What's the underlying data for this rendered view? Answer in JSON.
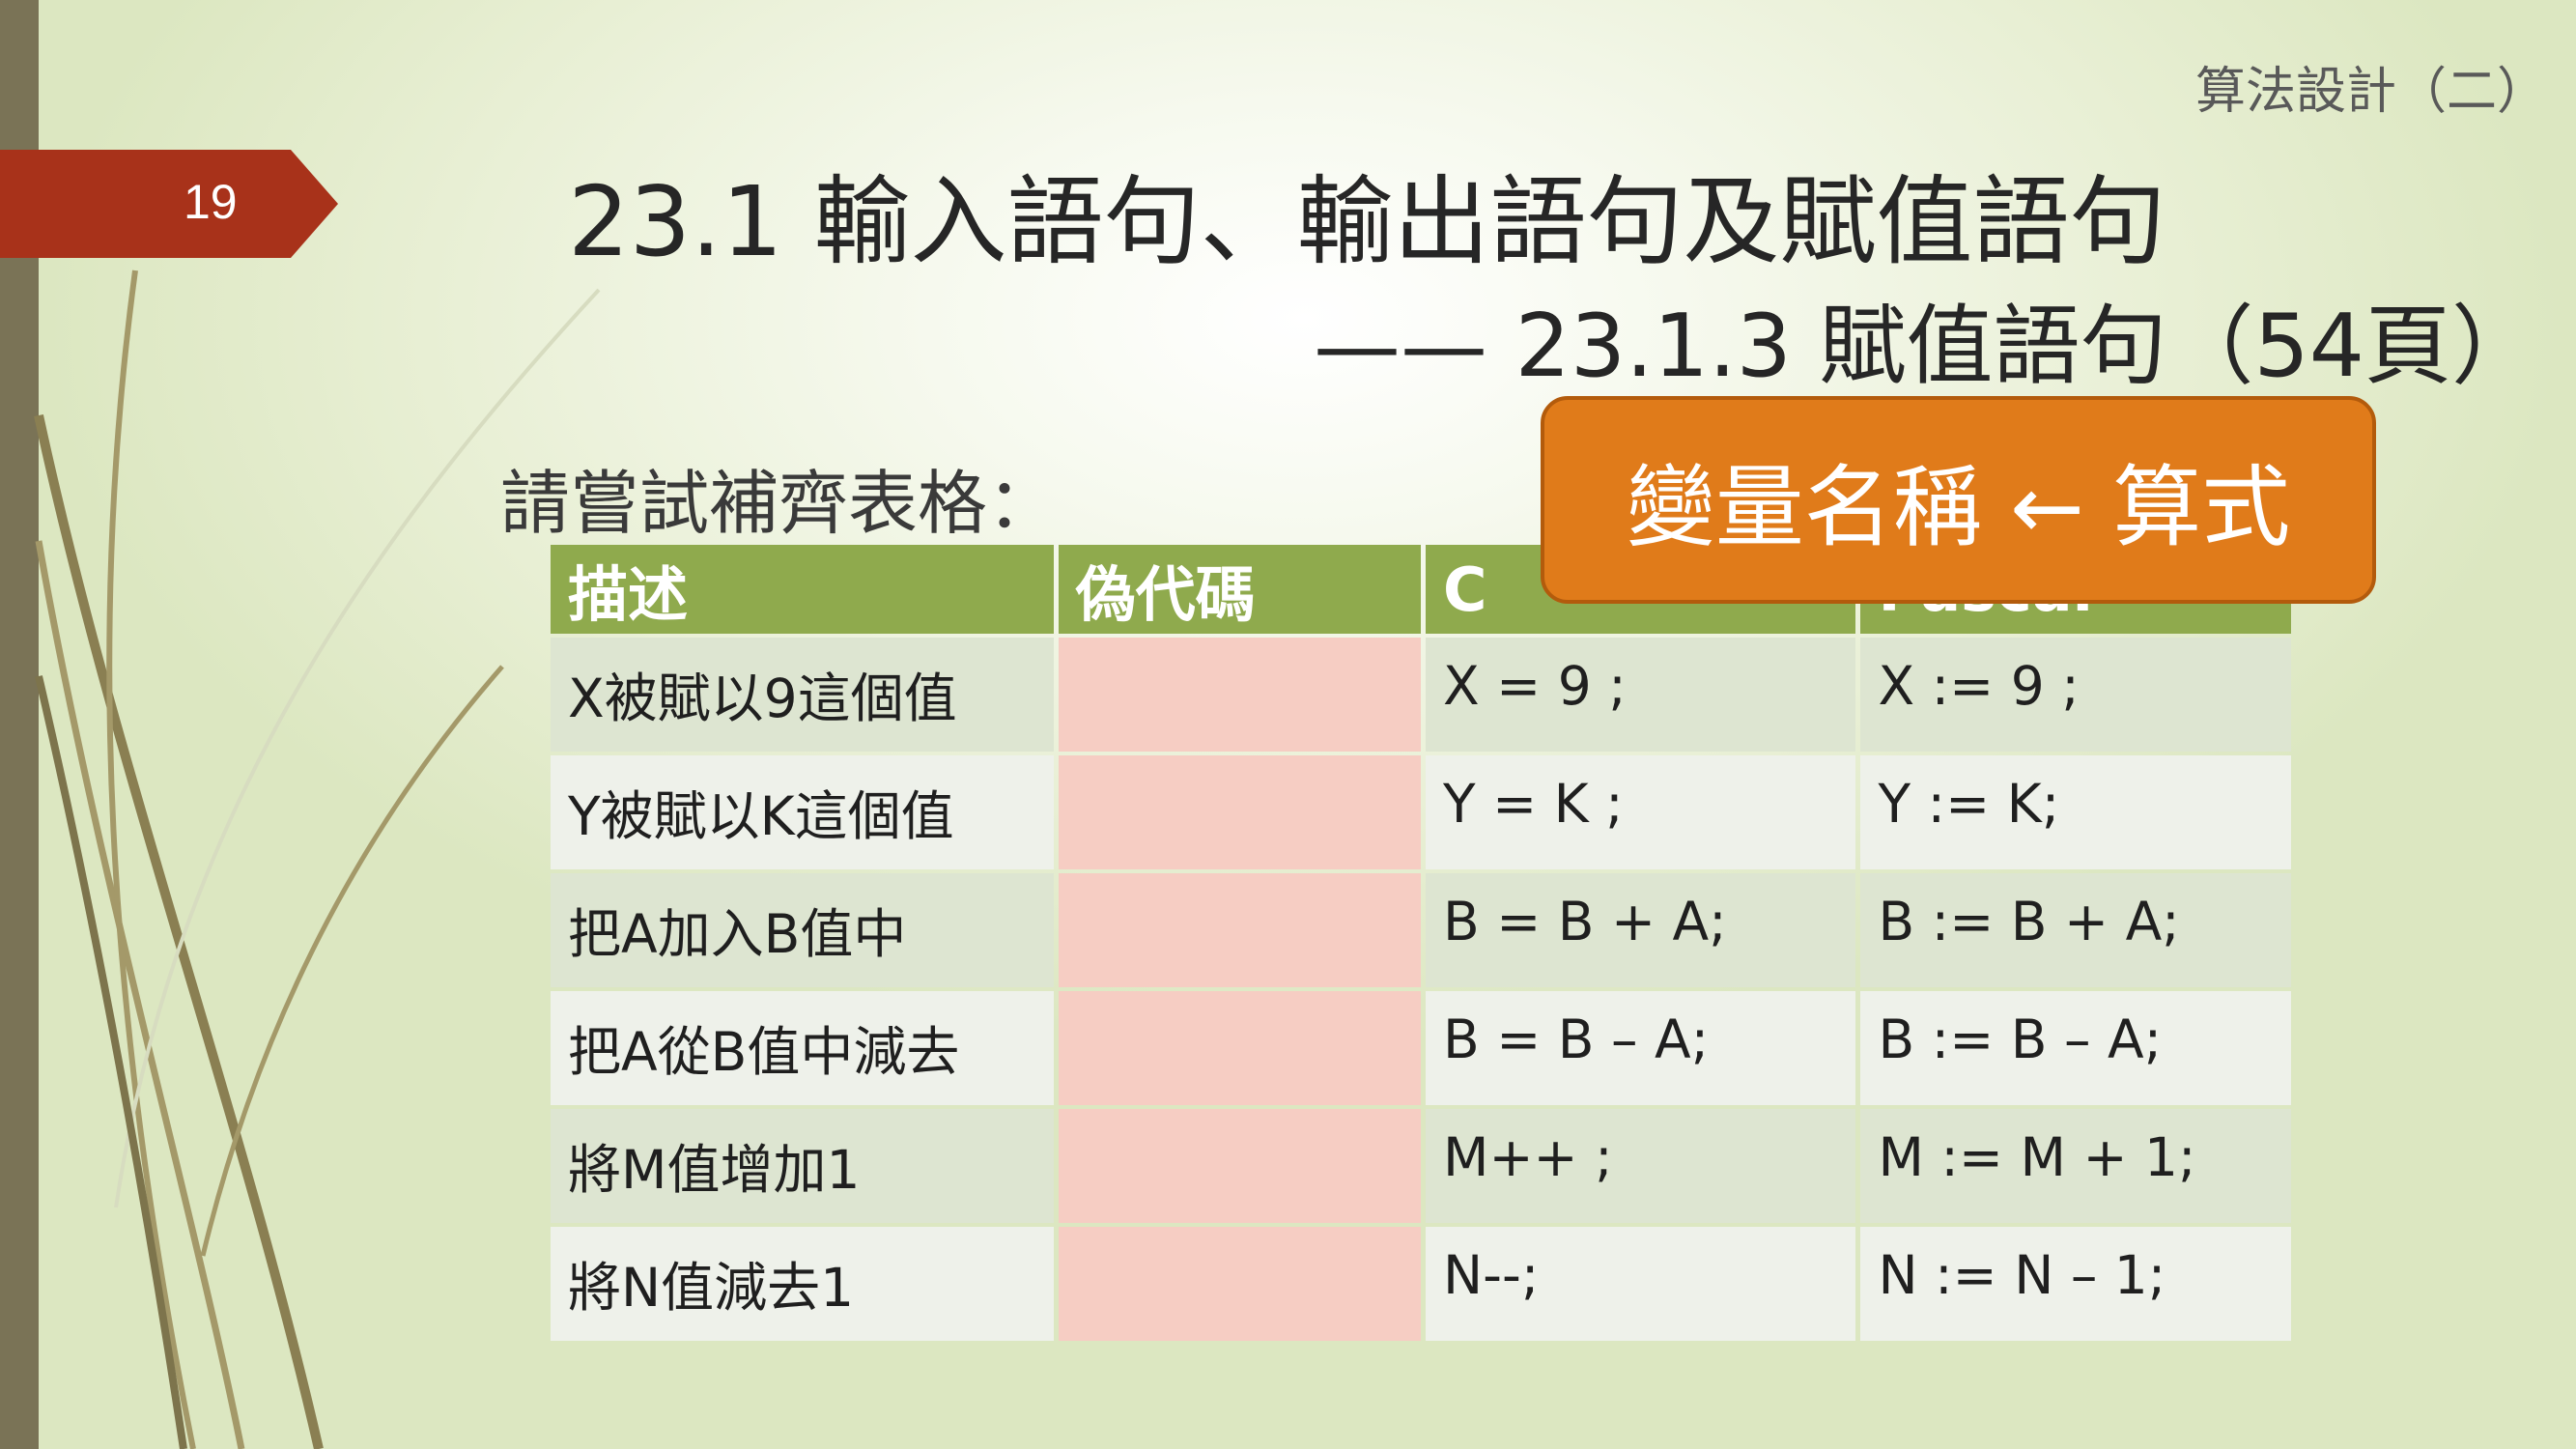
{
  "slide": {
    "number": "19",
    "header": "算法設計（二）",
    "title_line1": "23.1 輸入語句、輸出語句及賦值語句",
    "title_line2": "—— 23.1.3 賦值語句（54頁）",
    "prompt": "請嘗試補齊表格："
  },
  "callout": {
    "text": "變量名稱 ← 算式"
  },
  "table": {
    "headers": [
      "描述",
      "偽代碼",
      "C",
      "Pascal"
    ],
    "rows": [
      {
        "desc": "X被賦以9這個值",
        "pseudo": "",
        "c": "X = 9 ;",
        "pascal": "X := 9 ;"
      },
      {
        "desc": "Y被賦以K這個值",
        "pseudo": "",
        "c": "Y = K ;",
        "pascal": "Y := K;"
      },
      {
        "desc": "把A加入B值中",
        "pseudo": "",
        "c": "B = B + A;",
        "pascal": "B := B + A;"
      },
      {
        "desc": "把A從B值中減去",
        "pseudo": "",
        "c": "B = B – A;",
        "pascal": "B := B – A;"
      },
      {
        "desc": "將M值增加1",
        "pseudo": "",
        "c": "M++ ;",
        "pascal": "M := M + 1;"
      },
      {
        "desc": "將N值減去1",
        "pseudo": "",
        "c": "N--;",
        "pascal": "N := N – 1;"
      }
    ]
  },
  "colors": {
    "accent_red": "#a8321a",
    "header_green": "#8faa4d",
    "callout_orange": "#e07b1a",
    "pseudo_fill": "#f6cdc3"
  }
}
